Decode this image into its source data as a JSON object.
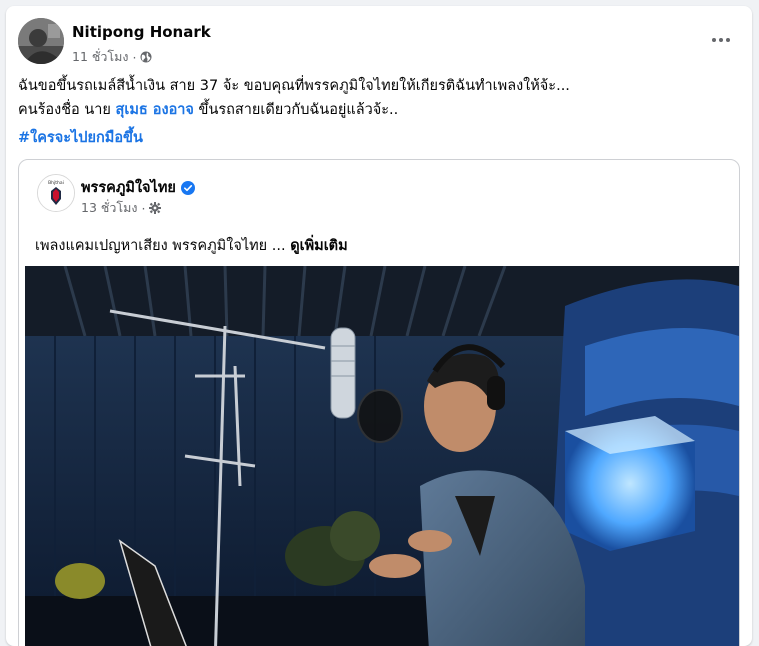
{
  "post": {
    "author": "Nitipong Honark",
    "time": "11 ชั่วโมง",
    "separator": "·",
    "line1": "ฉันขอขึ้นรถเมล์สีน้ำเงิน สาย 37  จ้ะ  ขอบคุณที่พรรคภูมิใจไทยให้เกียรติฉันทำเพลงให้จ้ะ...",
    "line2_prefix": "คนร้องชื่อ นาย ",
    "mention": "สุเมธ องอาจ",
    "line2_suffix": "  ขึ้นรถสายเดียวกับฉันอยู่แล้วจ้ะ..",
    "hashtag": "#ใครจะไปยกมือขึ้น"
  },
  "shared": {
    "page_name": "พรรคภูมิใจไทย",
    "logo_text": "Bhjthai",
    "time": "13 ชั่วโมง",
    "separator": "·",
    "text": "เพลงแคมเปญหาเสียง พรรคภูมิใจไทย ... ",
    "see_more": "ดูเพิ่มเติม"
  },
  "colors": {
    "link": "#1b74e4",
    "secondary_text": "#65676b",
    "verified": "#1877f2"
  },
  "icons": [
    "globe-icon",
    "more-options-icon",
    "verified-badge-icon",
    "settings-gear-icon"
  ]
}
